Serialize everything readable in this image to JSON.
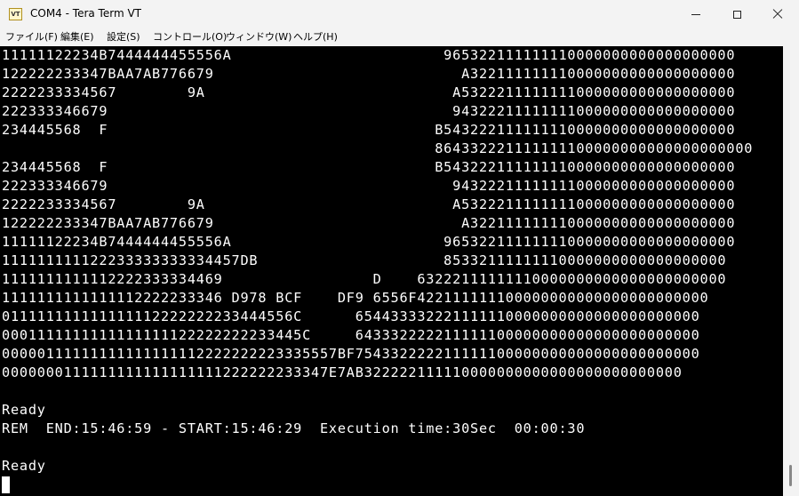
{
  "window": {
    "title": "COM4 - Tera Term VT",
    "icon_label": "VT",
    "icon": "tera-term-icon"
  },
  "menu": [
    {
      "label": "ファイル(F)"
    },
    {
      "label": "編集(E)"
    },
    {
      "label": "設定(S)"
    },
    {
      "label": "コントロール(O)"
    },
    {
      "label": "ウィンドウ(W)"
    },
    {
      "label": "ヘルプ(H)"
    }
  ],
  "terminal": {
    "lines": [
      "11111122234B7444444455556A                        965322111111110000000000000000000",
      "122222233347BAA7AB776679                            A322111111110000000000000000000",
      "2222233334567        9A                            A5322211111111000000000000000000",
      "222333346679                                       94322211111111000000000000000000",
      "234445568  F                                     B543222111111110000000000000000000",
      "                                                 864332221111111100000000000000000000",
      "234445568  F                                     B543222111111110000000000000000000",
      "222333346679                                       94322211111111000000000000000000",
      "2222233334567        9A                            A5322211111111000000000000000000",
      "122222233347BAA7AB776679                            A322111111110000000000000000000",
      "11111122234B7444444455556A                        965322111111110000000000000000000",
      "111111111122233333333334457DB                     85332111111110000000000000000000",
      "1111111111112222333334469                 D    63222111111110000000000000000000000",
      "1111111111111112222233346 D978 BCF    DF9 6556F422111111100000000000000000000000",
      "011111111111111112222222233444556C      654433332221111110000000000000000000000",
      "0001111111111111111122222222233445C     643332222211111100000000000000000000000",
      "00000111111111111111112222222223335557BF754332222211111100000000000000000000000",
      "0000000111111111111111111222222233347E7AB322222111110000000000000000000000000",
      "",
      "Ready",
      "REM  END:15:46:59 - START:15:46:29  Execution time:30Sec  00:00:30",
      "",
      "Ready"
    ]
  },
  "colors": {
    "terminal_bg": "#000000",
    "terminal_fg": "#ffffff",
    "chrome_bg": "#f3f3f3"
  }
}
